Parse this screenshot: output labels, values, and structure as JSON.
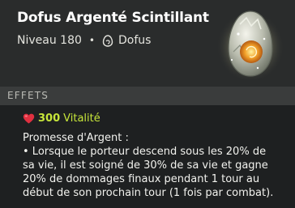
{
  "item": {
    "name": "Dofus Argenté Scintillant",
    "level": "Niveau 180",
    "separator": "•",
    "type": "Dofus"
  },
  "section": {
    "title": "EFFETS"
  },
  "effects": {
    "vitality": {
      "value": "300",
      "name": "Vitalité"
    },
    "description": [
      "Promesse d'Argent :",
      "• Lorsque le porteur descend sous les 20% de",
      "sa vie, il est soigné de 30% de sa vie et gagne",
      "20% de dommages finaux pendant 1 tour au",
      "début de son prochain tour (1 fois par combat)."
    ]
  },
  "icons": {
    "type_icon": "dofus-egg-icon",
    "vitality_icon": "heart-icon",
    "item_image": "silver-glittering-dofus-egg"
  },
  "colors": {
    "header_bg": "#2a2c2c",
    "section_bg": "#3a3c3c",
    "body_bg": "#1e2021",
    "vitality": "#c7e63a",
    "heart": "#e03040"
  }
}
